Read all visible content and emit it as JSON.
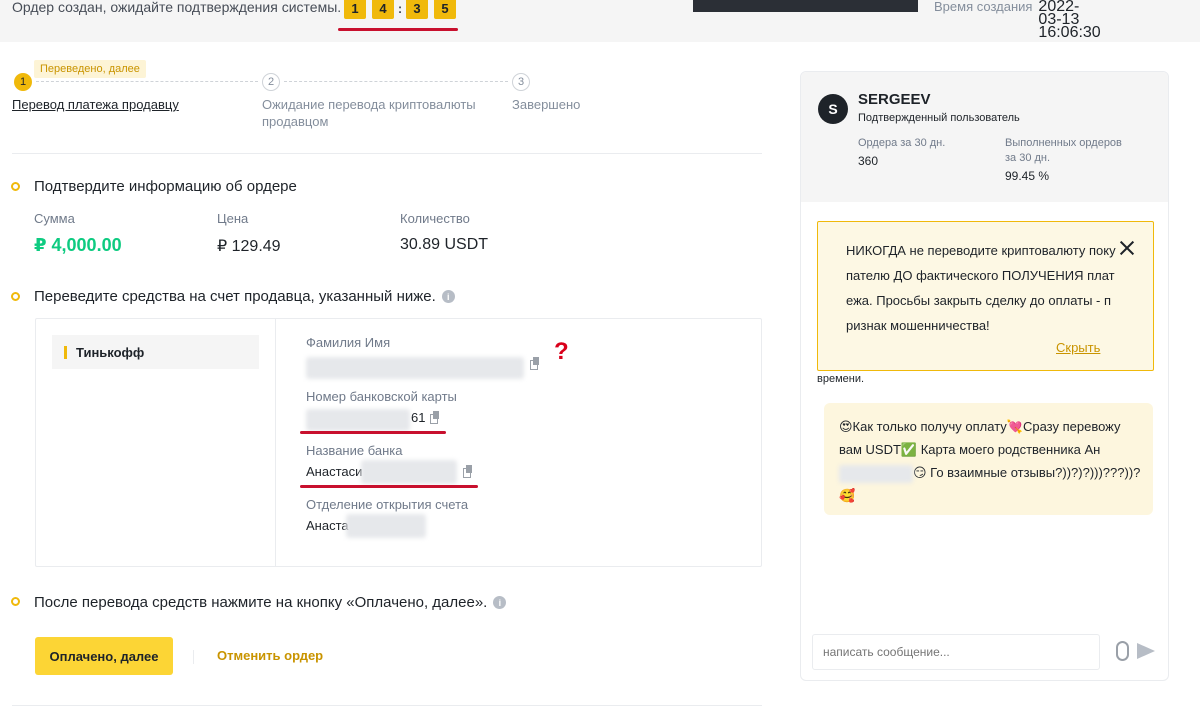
{
  "header": {
    "status_message": "Ордер создан, ожидайте подтверждения системы.",
    "timer_digits": [
      "1",
      "4",
      "3",
      "5"
    ],
    "timer_separator": ":",
    "created_label": "Время создания",
    "created_value": "2022-03-13 16:06:30"
  },
  "steps": {
    "badge": "Переведено, далее",
    "items": [
      {
        "num": "1",
        "label": "Перевод платежа продавцу"
      },
      {
        "num": "2",
        "label": "Ожидание перевода криптовалюты продавцом"
      },
      {
        "num": "3",
        "label": "Завершено"
      }
    ]
  },
  "confirm": {
    "title": "Подтвердите информацию об ордере",
    "amount_label": "Сумма",
    "amount_value": "₽ 4,000.00",
    "price_label": "Цена",
    "price_value": "₽ 129.49",
    "quantity_label": "Количество",
    "quantity_value": "30.89 USDT"
  },
  "transfer": {
    "title": "Переведите средства на счет продавца, указанный ниже.",
    "bank_tab": "Тинькофф",
    "fields": [
      {
        "label": "Фамилия Имя",
        "value": ""
      },
      {
        "label": "Номер банковской карты",
        "value": "61"
      },
      {
        "label": "Название банка",
        "value": "Анастаси"
      },
      {
        "label": "Отделение открытия счета",
        "value": "Анаста"
      }
    ],
    "annotation": "?"
  },
  "after": {
    "title": "После перевода средств нажмите на кнопку «Оплачено, далее».",
    "paid_button": "Оплачено, далее",
    "cancel_button": "Отменить ордер"
  },
  "seller": {
    "avatar_letter": "S",
    "name": "SERGEEV",
    "verified": "Подтвержденный пользователь",
    "orders_label": "Ордера за 30 дн.",
    "orders_value": "360",
    "completed_label_1": "Выполненных ордеров",
    "completed_label_2": "за 30 дн.",
    "completed_value": "99.45 %"
  },
  "warning": {
    "text": "НИКОГДА не переводите криптовалюту покупателю ДО фактического ПОЛУЧЕНИЯ платежа. Просьбы закрыть сделку до оплаты - признак мошенничества!",
    "hide": "Скрыть",
    "trailing": "времени."
  },
  "chat": {
    "message_part1": "😍Как только получу оплату💘Сразу перевожу вам USDT✅ Карта моего родственника Ан",
    "message_part2": "😏 Го взаимные отзывы?))?)?)))???))?🥰",
    "input_placeholder": "написать сообщение..."
  },
  "colors": {
    "accent": "#f0b90b",
    "button": "#fcd535",
    "green": "#0ecb81",
    "annotation_red": "#c8102e"
  }
}
